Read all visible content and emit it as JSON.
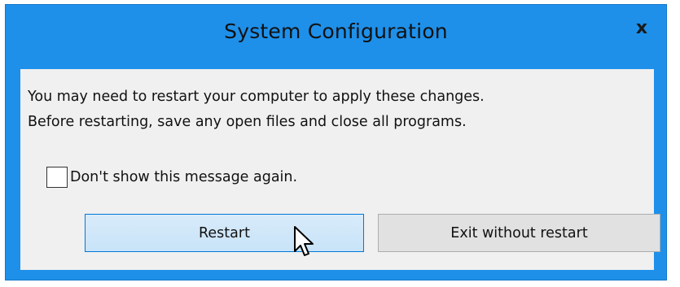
{
  "window": {
    "title": "System Configuration",
    "close_label": "x"
  },
  "message": {
    "line1": "You may need to restart your computer to apply these changes.",
    "line2": "Before restarting, save any open files and close all programs."
  },
  "checkbox": {
    "label": "Don't show this message again.",
    "checked": false
  },
  "buttons": {
    "restart_label": "Restart",
    "exit_label": "Exit without restart"
  },
  "colors": {
    "frame": "#1e90ea",
    "client": "#f0f0f0",
    "restart_bg": "#cce4f7",
    "restart_border": "#0078d7",
    "exit_bg": "#e1e1e1"
  },
  "icons": {
    "cursor": "hand-pointer-cursor-icon"
  }
}
